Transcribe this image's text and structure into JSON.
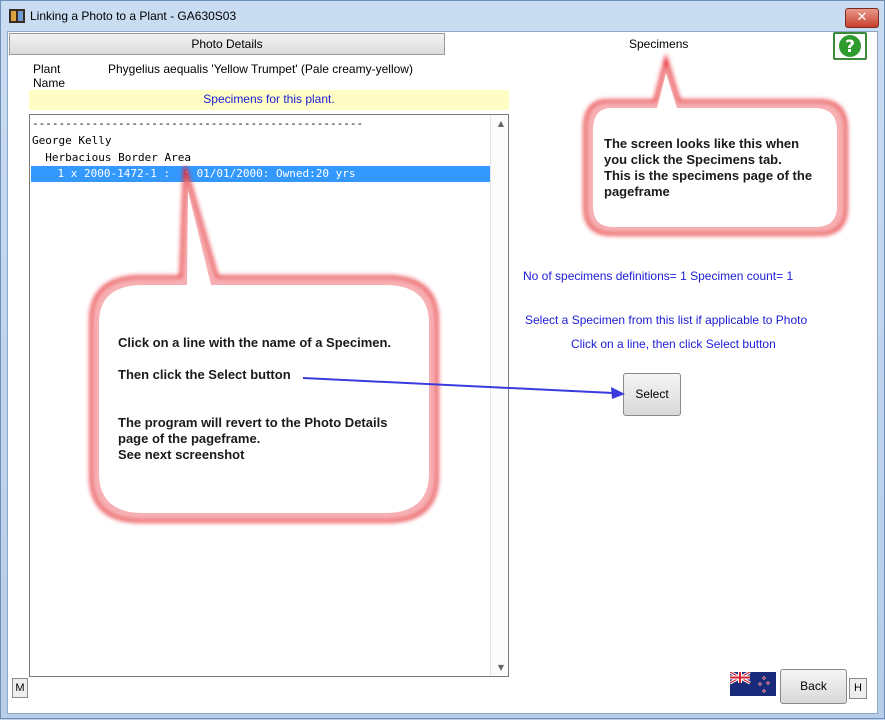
{
  "window": {
    "title": "Linking a Photo to a Plant - GA630S03",
    "close_label": "✕"
  },
  "tabs": {
    "photo_details": "Photo Details",
    "specimens": "Specimens"
  },
  "plant": {
    "label_line1": "Plant",
    "label_line2": "Name",
    "name": "Phygelius aequalis 'Yellow Trumpet' (Pale creamy-yellow)"
  },
  "specimen_list": {
    "header": "Specimens for this plant.",
    "rows": [
      "--------------------------------------------------",
      "George Kelly",
      "  Herbacious Border Area",
      "    1 x 2000-1472-1 :  : 01/01/2000: Owned:20 yrs"
    ],
    "selected_index": 3
  },
  "info": {
    "count_text": "No of specimens definitions= 1 Specimen count= 1",
    "instruction1": "Select a Specimen from this list if applicable to Photo",
    "instruction2": "Click on  a line, then click Select button"
  },
  "buttons": {
    "select": "Select",
    "back": "Back",
    "m": "M",
    "h": "H",
    "help": "?"
  },
  "callouts": {
    "top": [
      "The screen looks like this when",
      "you click the Specimens tab.",
      "This is the specimens page of the",
      "pageframe"
    ],
    "main_line1": "Click on a line with the name of a Specimen.",
    "main_line2": "Then click the Select button",
    "main_line3": [
      "The program will revert to the Photo Details",
      "page of the pageframe.",
      "See next screenshot"
    ]
  },
  "colors": {
    "accent_blue": "#1b1bd6",
    "selection": "#3399ff",
    "callout_border": "#e8202a",
    "yellow_bar": "#fdfdc5"
  },
  "icons": {
    "app": "app-film-icon",
    "help": "help-question-icon",
    "flag": "new-zealand-flag-icon"
  }
}
